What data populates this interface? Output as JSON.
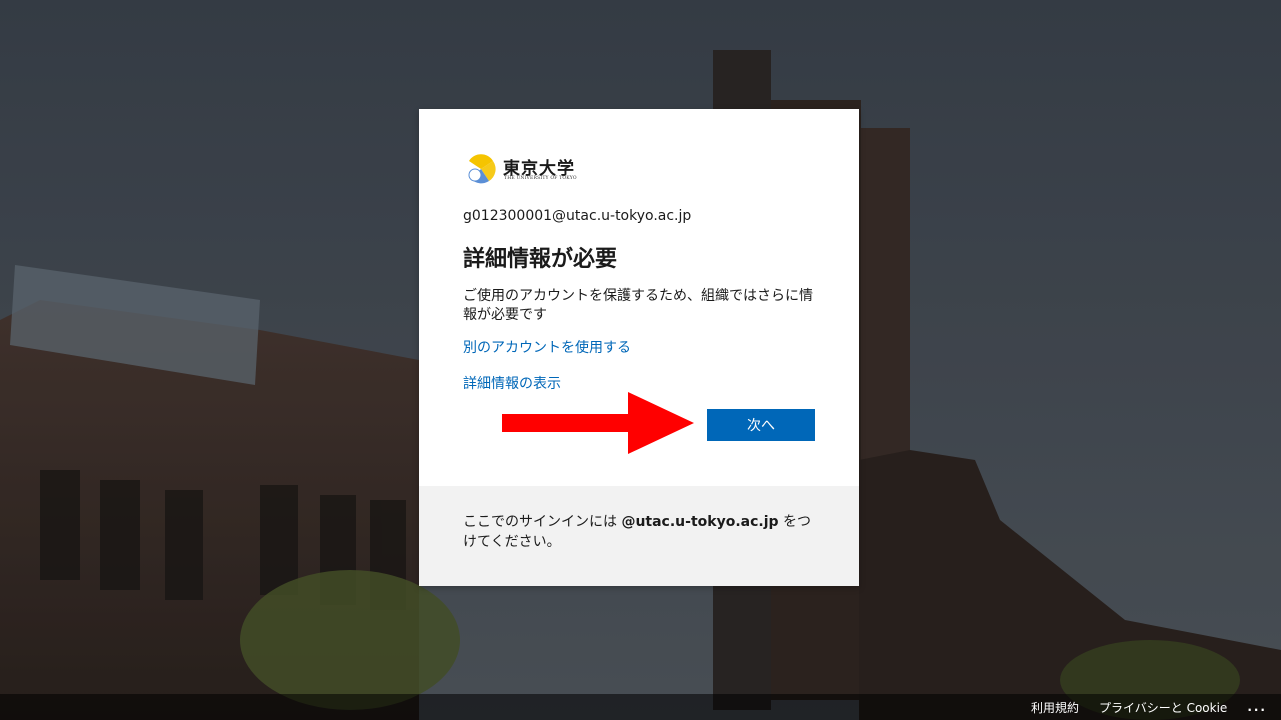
{
  "logo": {
    "name_jp": "東京大学",
    "name_en": "THE UNIVERSITY OF TOKYO",
    "colors": {
      "gold": "#f5c400",
      "blue": "#5b8fd6"
    }
  },
  "signin": {
    "email": "g012300001@utac.u-tokyo.ac.jp",
    "title": "詳細情報が必要",
    "description": "ご使用のアカウントを保護するため、組織ではさらに情報が必要です",
    "use_another_account": "別のアカウントを使用する",
    "more_info": "詳細情報の表示",
    "next_button": "次へ"
  },
  "footer_hint": {
    "prefix": "ここでのサインインには ",
    "domain": "@utac.u-tokyo.ac.jp",
    "suffix": " をつけてください。"
  },
  "bottom_bar": {
    "terms": "利用規約",
    "privacy": "プライバシーと Cookie",
    "more": "..."
  },
  "colors": {
    "accent": "#0067b8",
    "annotation_arrow": "#ff0000"
  }
}
